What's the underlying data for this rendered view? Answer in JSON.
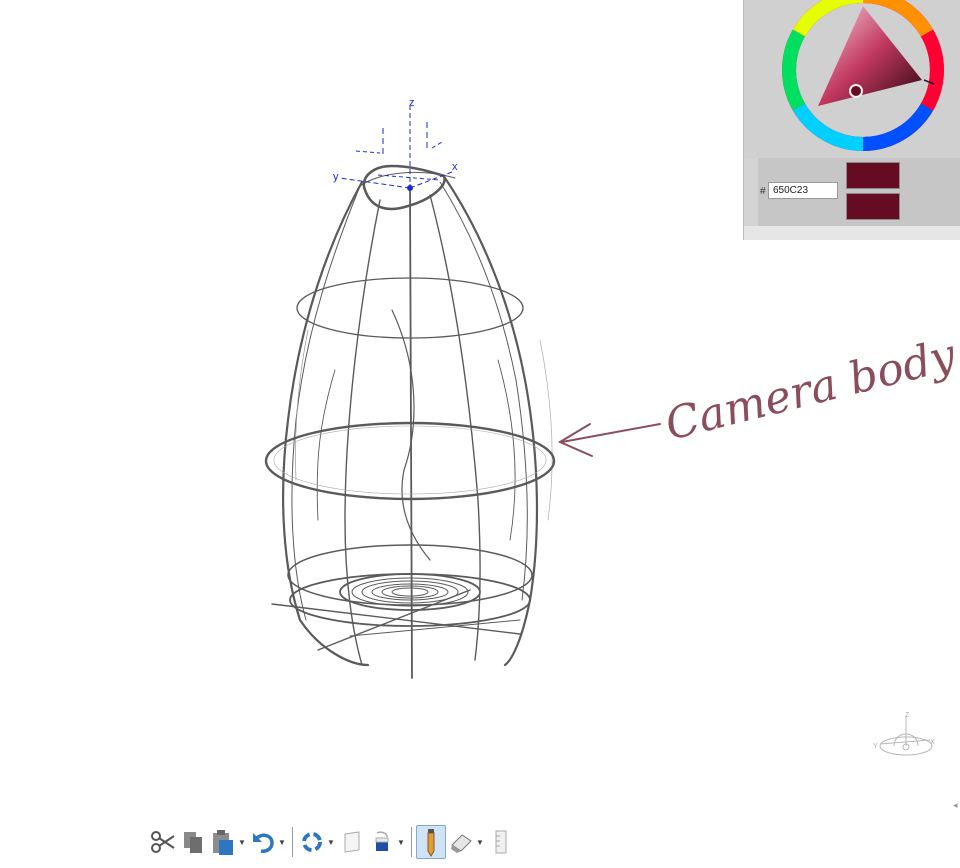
{
  "canvas": {
    "annotation_text": "Camera body",
    "axis_labels": {
      "x": "x",
      "y": "y",
      "z": "z"
    }
  },
  "color_picker": {
    "hash_label": "#",
    "hex_value": "650C23",
    "current_color": "#650C23",
    "previous_color": "#650C23"
  },
  "nav_cube": {
    "x": "X",
    "y": "Y",
    "z": "Z"
  },
  "toolbar": {
    "tools": [
      {
        "name": "cut-icon"
      },
      {
        "name": "copy-icon"
      },
      {
        "name": "paste-icon"
      },
      {
        "name": "undo-icon"
      },
      {
        "name": "rotate-view-icon"
      },
      {
        "name": "layer-icon"
      },
      {
        "name": "fill-icon"
      },
      {
        "name": "pencil-icon",
        "active": true
      },
      {
        "name": "eraser-icon"
      },
      {
        "name": "ruler-icon"
      }
    ]
  },
  "colors": {
    "ink": "#650C23",
    "sketch": "#555555",
    "axis": "#1a2bd6",
    "active_tool_bg": "#cfe3f7"
  }
}
